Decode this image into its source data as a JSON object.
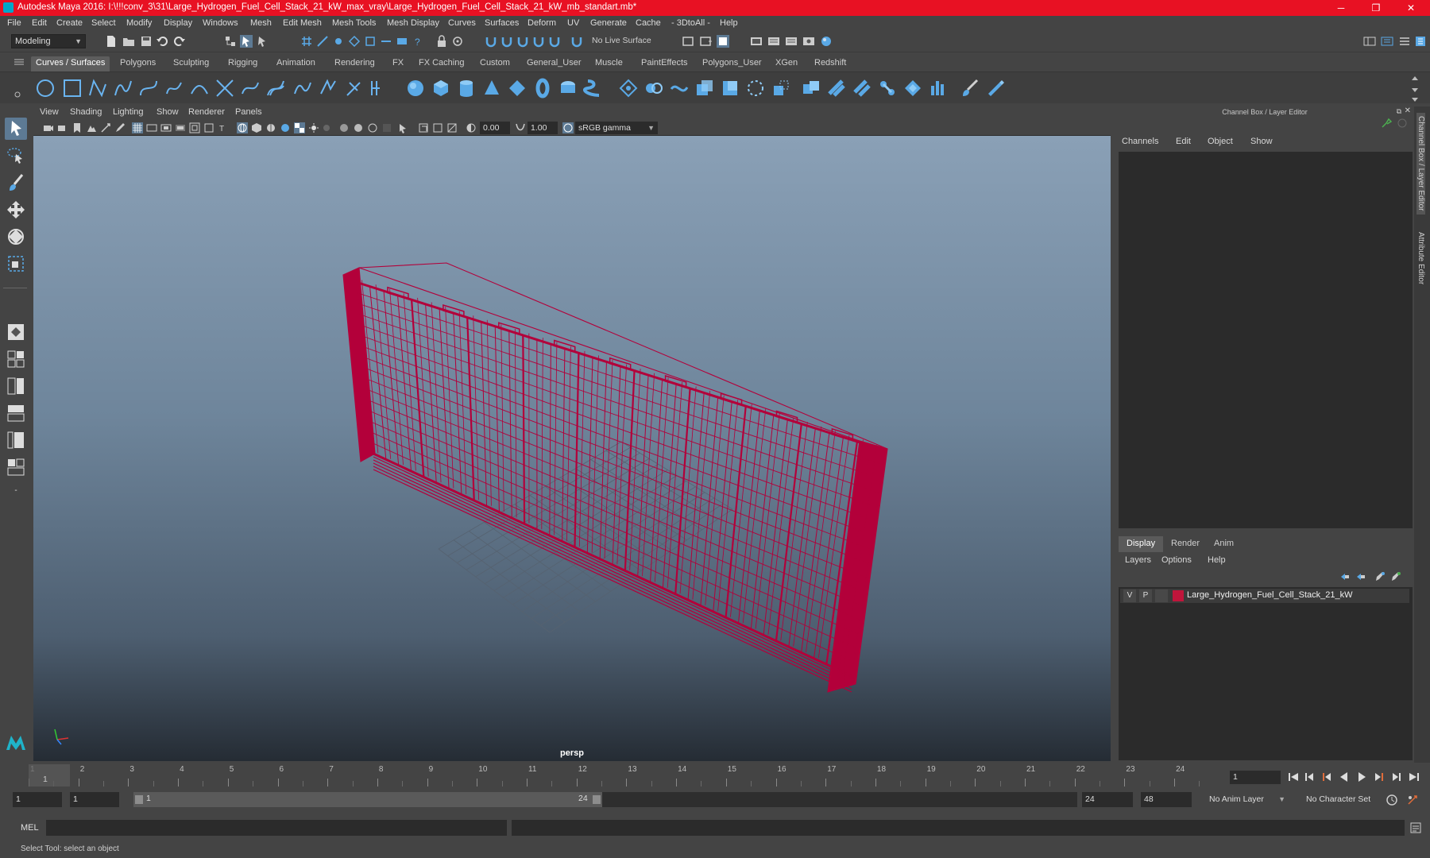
{
  "app": {
    "title": "Autodesk Maya 2016: I:\\!!!conv_3\\31\\Large_Hydrogen_Fuel_Cell_Stack_21_kW_max_vray\\Large_Hydrogen_Fuel_Cell_Stack_21_kW_mb_standart.mb*",
    "minimize": "─",
    "maximize": "❐",
    "close": "✕"
  },
  "menu": [
    "File",
    "Edit",
    "Create",
    "Select",
    "Modify",
    "Display",
    "Windows",
    "Mesh",
    "Edit Mesh",
    "Mesh Tools",
    "Mesh Display",
    "Curves",
    "Surfaces",
    "Deform",
    "UV",
    "Generate",
    "Cache",
    "- 3DtoAll -",
    "Help"
  ],
  "toolbar": {
    "mode": "Modeling",
    "live_surface": "No Live Surface"
  },
  "shelf_tabs": [
    "Curves / Surfaces",
    "Polygons",
    "Sculpting",
    "Rigging",
    "Animation",
    "Rendering",
    "FX",
    "FX Caching",
    "Custom",
    "General_User",
    "Muscle",
    "PaintEffects",
    "Polygons_User",
    "XGen",
    "Redshift"
  ],
  "panel_menu": [
    "View",
    "Shading",
    "Lighting",
    "Show",
    "Renderer",
    "Panels"
  ],
  "panel_tools": {
    "exposure": "0.00",
    "gamma": "1.00",
    "color_space": "sRGB gamma"
  },
  "viewport": {
    "camera": "persp",
    "wire_color": "#b3003a"
  },
  "channel_box": {
    "title": "Channel Box / Layer Editor",
    "menu": [
      "Channels",
      "Edit",
      "Object",
      "Show"
    ]
  },
  "layer_editor": {
    "tabs": [
      "Display",
      "Render",
      "Anim"
    ],
    "menu": [
      "Layers",
      "Options",
      "Help"
    ],
    "layer": {
      "v": "V",
      "p": "P",
      "name": "Large_Hydrogen_Fuel_Cell_Stack_21_kW",
      "color": "#c0153b"
    }
  },
  "side_tabs": [
    "Channel Box / Layer Editor",
    "Attribute Editor"
  ],
  "timeline": {
    "ticks": [
      "1",
      "2",
      "3",
      "4",
      "5",
      "6",
      "7",
      "8",
      "9",
      "10",
      "11",
      "12",
      "13",
      "14",
      "15",
      "16",
      "17",
      "18",
      "19",
      "20",
      "21",
      "22",
      "23",
      "24"
    ],
    "current": "1",
    "current_frame_field": "1"
  },
  "range": {
    "start": "1",
    "anim_start": "1",
    "slider_start": "1",
    "slider_end": "24",
    "anim_end": "24",
    "end": "48",
    "anim_layer": "No Anim Layer",
    "character_set": "No Character Set"
  },
  "command_line": {
    "label": "MEL"
  },
  "help_line": "Select Tool: select an object"
}
